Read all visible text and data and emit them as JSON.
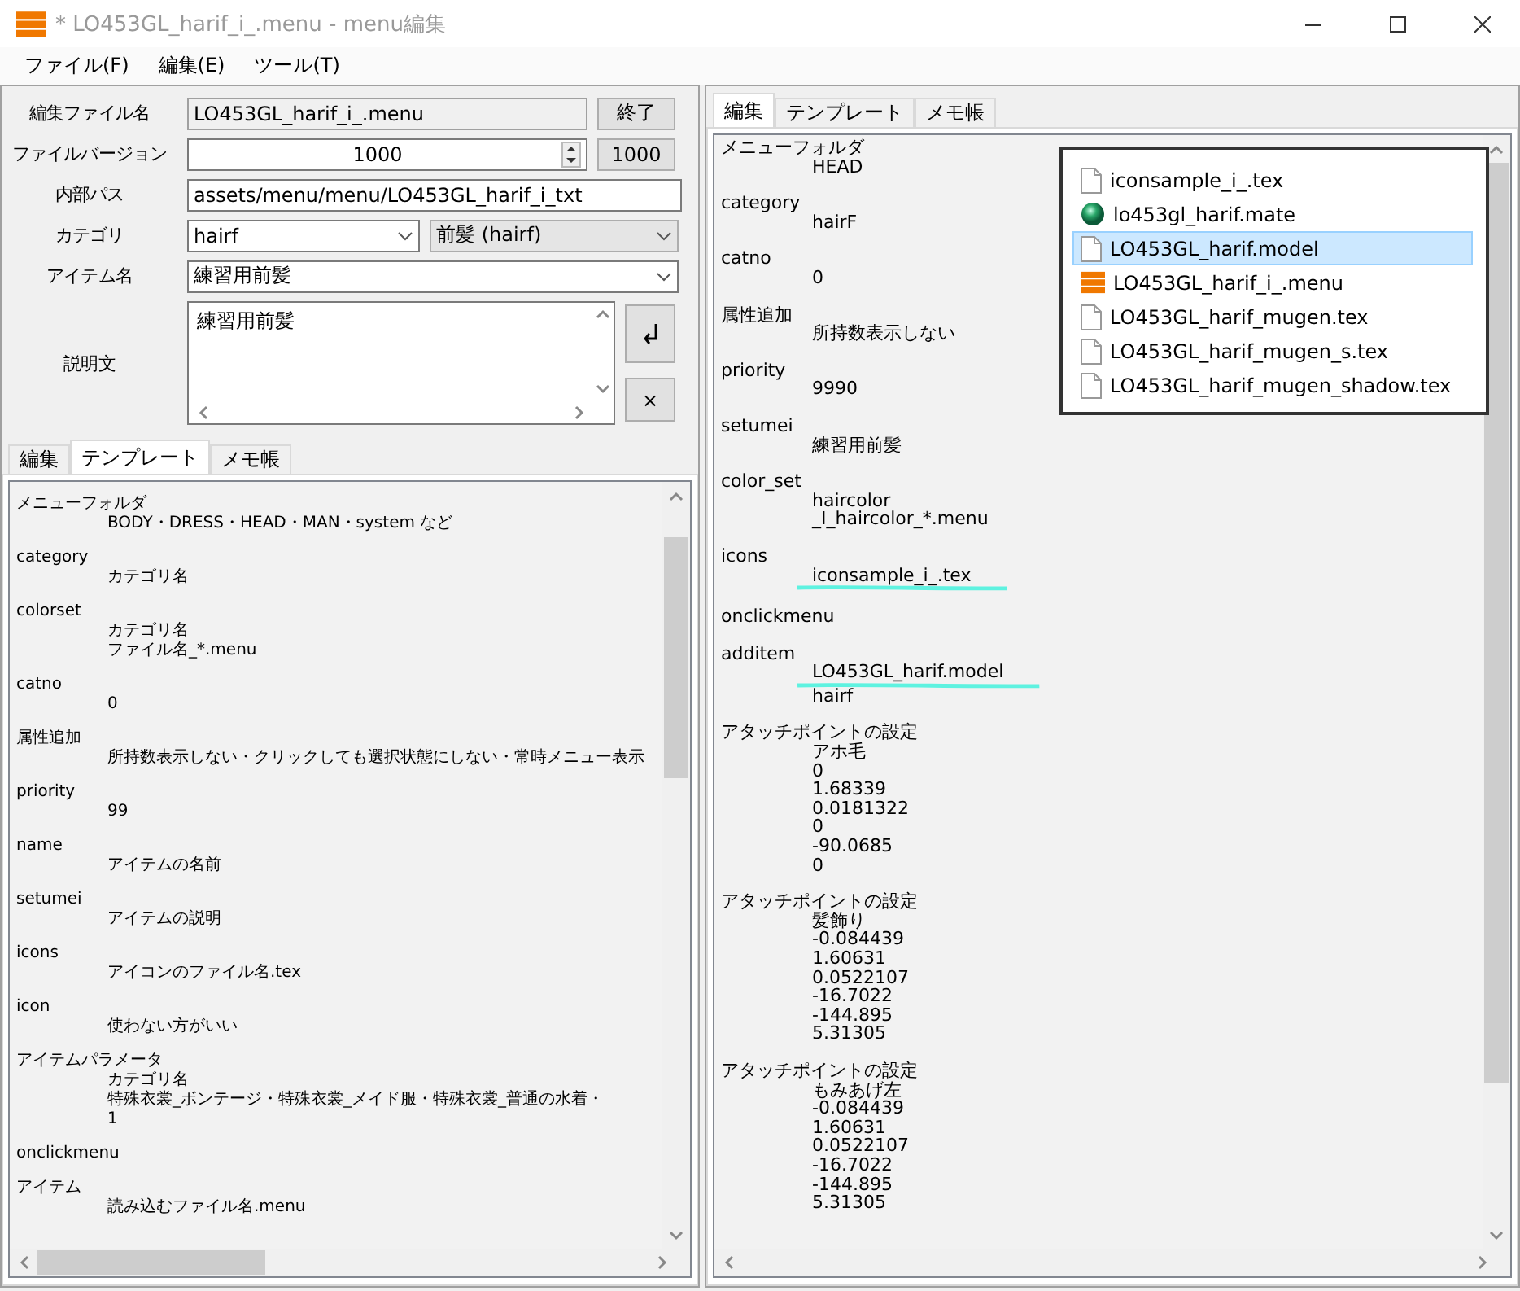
{
  "window": {
    "title": "* LO453GL_harif_i_.menu - menu編集"
  },
  "menu_bar": [
    "ファイル(F)",
    "編集(E)",
    "ツール(T)"
  ],
  "form": {
    "file_name": {
      "label": "編集ファイル名",
      "value": "LO453GL_harif_i_.menu",
      "button": "終了"
    },
    "file_version": {
      "label": "ファイルバージョン",
      "value": "1000",
      "button": "1000"
    },
    "internal_path": {
      "label": "内部パス",
      "value": "assets/menu/menu/LO453GL_harif_i_txt"
    },
    "category": {
      "label": "カテゴリ",
      "value": "hairf",
      "display": "前髪 (hairf)"
    },
    "item_name": {
      "label": "アイテム名",
      "value": "練習用前髪"
    },
    "description": {
      "label": "説明文",
      "value": "練習用前髪",
      "clear_button": "×"
    }
  },
  "left_tabs": [
    {
      "label": "編集",
      "selected": false
    },
    {
      "label": "テンプレート",
      "selected": true
    },
    {
      "label": "メモ帳",
      "selected": false
    }
  ],
  "left_template": [
    {
      "key": "メニューフォルダ",
      "values": [
        "BODY・DRESS・HEAD・MAN・system など"
      ]
    },
    {
      "key": "category",
      "values": [
        "カテゴリ名"
      ]
    },
    {
      "key": "colorset",
      "values": [
        "カテゴリ名",
        "ファイル名_*.menu"
      ]
    },
    {
      "key": "catno",
      "values": [
        "0"
      ]
    },
    {
      "key": "属性追加",
      "values": [
        "所持数表示しない・クリックしても選択状態にしない・常時メニュー表示"
      ]
    },
    {
      "key": "priority",
      "values": [
        "99"
      ]
    },
    {
      "key": "name",
      "values": [
        "アイテムの名前"
      ]
    },
    {
      "key": "setumei",
      "values": [
        "アイテムの説明"
      ]
    },
    {
      "key": "icons",
      "values": [
        "アイコンのファイル名.tex"
      ]
    },
    {
      "key": "icon",
      "values": [
        "使わない方がいい"
      ]
    },
    {
      "key": "アイテムパラメータ",
      "values": [
        "カテゴリ名",
        "特殊衣裳_ボンテージ・特殊衣裳_メイド服・特殊衣裳_普通の水着・",
        "1"
      ]
    },
    {
      "key": "onclickmenu"
    },
    {
      "key": "アイテム",
      "values": [
        "読み込むファイル名.menu"
      ]
    }
  ],
  "right_tabs": [
    {
      "label": "編集",
      "selected": true
    },
    {
      "label": "テンプレート",
      "selected": false
    },
    {
      "label": "メモ帳",
      "selected": false
    }
  ],
  "right_entries": [
    {
      "key": "メニューフォルダ",
      "values": [
        "HEAD"
      ],
      "marked": false
    },
    {
      "key": "category",
      "values": [
        "hairF"
      ],
      "marked": false
    },
    {
      "key": "catno",
      "values": [
        "0"
      ],
      "marked": false
    },
    {
      "key": "属性追加",
      "values": [
        "所持数表示しない"
      ],
      "marked": false
    },
    {
      "key": "priority",
      "values": [
        "9990"
      ],
      "marked": false
    },
    {
      "key": "setumei",
      "values": [
        "練習用前髪"
      ],
      "marked": false
    },
    {
      "key": "color_set",
      "values": [
        "haircolor",
        "_I_haircolor_*.menu"
      ],
      "marked": false
    },
    {
      "key": "icons",
      "values": [
        "iconsample_i_.tex"
      ],
      "marked": true
    },
    {
      "key": "onclickmenu",
      "marked": false
    },
    {
      "key": "additem",
      "values": [
        "LO453GL_harif.model",
        "hairf"
      ],
      "marked": true
    },
    {
      "key": "アタッチポイントの設定",
      "values": [
        "アホ毛",
        "0",
        "1.68339",
        "0.0181322",
        "0",
        "-90.0685",
        "0"
      ],
      "marked": false
    },
    {
      "key": "アタッチポイントの設定",
      "values": [
        "髪飾り",
        "-0.084439",
        "1.60631",
        "0.0522107",
        "-16.7022",
        "-144.895",
        "5.31305"
      ],
      "marked": false
    },
    {
      "key": "アタッチポイントの設定",
      "values": [
        "もみあげ左",
        "-0.084439",
        "1.60631",
        "0.0522107",
        "-16.7022",
        "-144.895",
        "5.31305"
      ],
      "marked": false
    }
  ],
  "file_popup": [
    {
      "name": "iconsample_i_.tex",
      "kind": "file",
      "selected": false
    },
    {
      "name": "lo453gl_harif.mate",
      "kind": "material",
      "selected": false
    },
    {
      "name": "LO453GL_harif.model",
      "kind": "file",
      "selected": true
    },
    {
      "name": "LO453GL_harif_i_.menu",
      "kind": "menu",
      "selected": false
    },
    {
      "name": "LO453GL_harif_mugen.tex",
      "kind": "file",
      "selected": false
    },
    {
      "name": "LO453GL_harif_mugen_s.tex",
      "kind": "file",
      "selected": false
    },
    {
      "name": "LO453GL_harif_mugen_shadow.tex",
      "kind": "file",
      "selected": false
    }
  ]
}
